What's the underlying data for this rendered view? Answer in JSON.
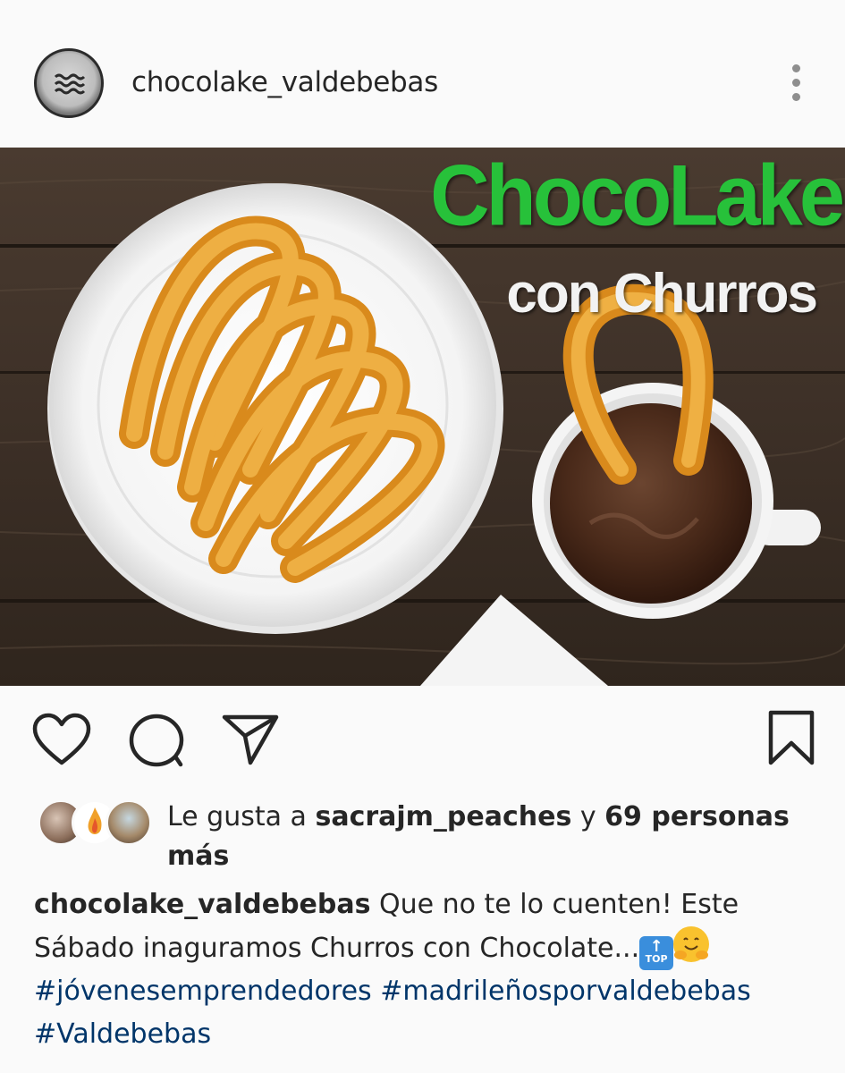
{
  "header": {
    "username": "chocolake_valdebebas"
  },
  "post": {
    "image": {
      "title": "ChocoLake",
      "subtitle": "con Churros"
    }
  },
  "likes": {
    "prefix": "Le gusta a ",
    "user": "sacrajm_peaches",
    "connector": " y ",
    "count_text": "69 personas más"
  },
  "caption": {
    "username": "chocolake_valdebebas",
    "text": " Que no te lo cuenten! Este Sábado inaguramos Churros con Chocolate...",
    "emoji_top_label": "TOP",
    "hashtags": [
      "#jóvenesemprendedores",
      "#madrileñosporvaldebebas",
      "#Valdebebas"
    ]
  },
  "colors": {
    "hashtag": "#003569",
    "title_green": "#27c13a",
    "text": "#262626"
  }
}
